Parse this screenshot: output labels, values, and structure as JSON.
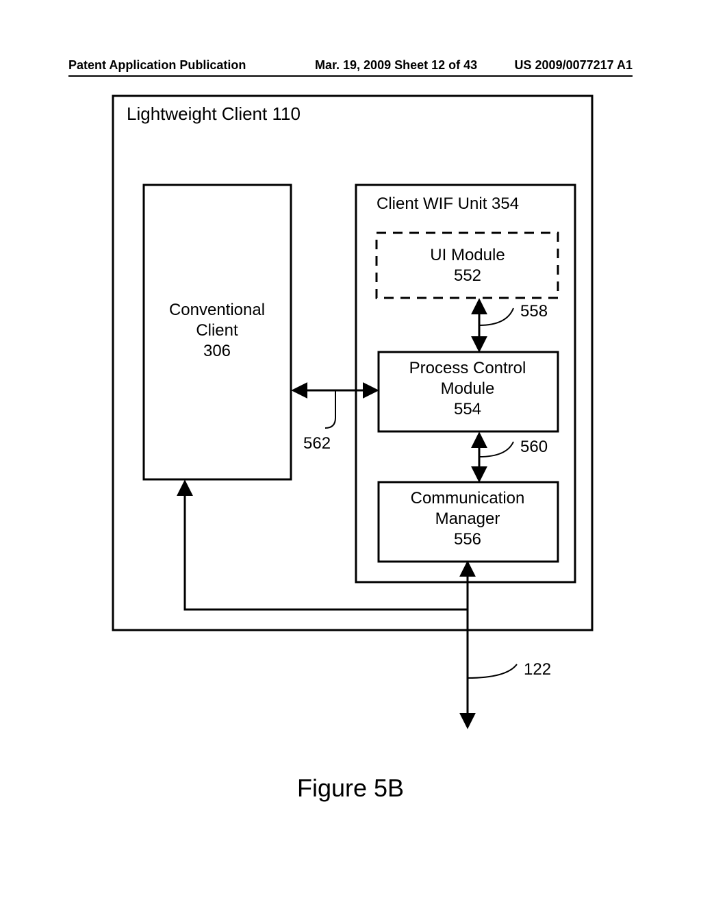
{
  "header": {
    "left": "Patent Application Publication",
    "mid": "Mar. 19, 2009  Sheet 12 of 43",
    "right": "US 2009/0077217 A1"
  },
  "diagram": {
    "outer_label": "Lightweight Client 110",
    "conventional_client_l1": "Conventional",
    "conventional_client_l2": "Client",
    "conventional_client_l3": "306",
    "wif_unit_label": "Client WIF Unit 354",
    "ui_module_l1": "UI Module",
    "ui_module_l2": "552",
    "process_ctrl_l1": "Process Control",
    "process_ctrl_l2": "Module",
    "process_ctrl_l3": "554",
    "comm_mgr_l1": "Communication",
    "comm_mgr_l2": "Manager",
    "comm_mgr_l3": "556",
    "ref_558": "558",
    "ref_562": "562",
    "ref_560": "560",
    "ref_122": "122"
  },
  "figure_caption": "Figure 5B"
}
